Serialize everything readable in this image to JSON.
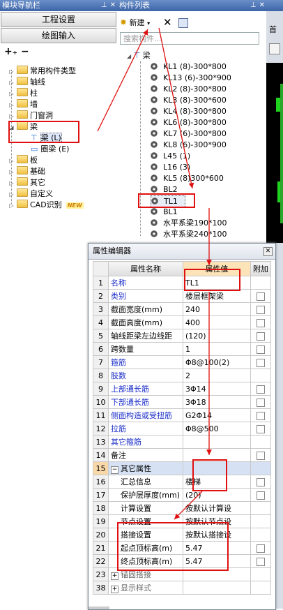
{
  "nav": {
    "title": "模块导航栏",
    "btn_project": "工程设置",
    "btn_draw": "绘图输入",
    "tree": [
      {
        "label": "常用构件类型",
        "exp": "▷"
      },
      {
        "label": "轴线",
        "exp": "▷"
      },
      {
        "label": "柱",
        "exp": "▷"
      },
      {
        "label": "墙",
        "exp": "▷"
      },
      {
        "label": "门窗洞",
        "exp": "▷"
      },
      {
        "label": "梁",
        "exp": "◢"
      },
      {
        "label": "梁 (L)",
        "exp": ""
      },
      {
        "label": "圈梁 (E)",
        "exp": ""
      },
      {
        "label": "板",
        "exp": "▷"
      },
      {
        "label": "基础",
        "exp": "▷"
      },
      {
        "label": "其它",
        "exp": "▷"
      },
      {
        "label": "自定义",
        "exp": "▷"
      },
      {
        "label": "CAD识别",
        "exp": "▷",
        "badge": "NEW"
      }
    ]
  },
  "comp": {
    "title": "构件列表",
    "new_label": "新建",
    "search_placeholder": "搜索构件...",
    "root": "梁",
    "items": [
      "KL1 (8)-300*800",
      "KL13 (6)-300*900",
      "KL2 (8)-300*800",
      "KL3 (8)-300*600",
      "KL4 (8)-300*800",
      "KL6 (8)-300*800",
      "KL7 (6)-300*800",
      "KL8 (6)-300*900",
      "L45 (1)",
      "L16 (3)",
      "KL5 (8)300*600",
      "BL2",
      "TL1",
      "BL1",
      "水平系梁190*100",
      "水平系梁240*100"
    ]
  },
  "strip": {
    "top_text": "首"
  },
  "prop": {
    "title": "属性编辑器",
    "col_name": "属性名称",
    "col_value": "属性值",
    "col_add": "附加",
    "rows": [
      {
        "n": "1",
        "name": "名称",
        "val": "TL1",
        "blue": true,
        "cb": false
      },
      {
        "n": "2",
        "name": "类别",
        "val": "楼层框架梁",
        "blue": true,
        "cb": true
      },
      {
        "n": "3",
        "name": "截面宽度(mm)",
        "val": "240",
        "blue": false,
        "cb": true
      },
      {
        "n": "4",
        "name": "截面高度(mm)",
        "val": "400",
        "blue": false,
        "cb": true
      },
      {
        "n": "5",
        "name": "轴线距梁左边线距",
        "val": "(120)",
        "blue": false,
        "cb": true
      },
      {
        "n": "6",
        "name": "跨数量",
        "val": "1",
        "blue": false,
        "cb": true
      },
      {
        "n": "7",
        "name": "箍筋",
        "val": "Φ8@100(2)",
        "blue": true,
        "cb": true
      },
      {
        "n": "8",
        "name": "肢数",
        "val": "2",
        "blue": true,
        "cb": false
      },
      {
        "n": "9",
        "name": "上部通长筋",
        "val": "3Φ14",
        "blue": true,
        "cb": true
      },
      {
        "n": "10",
        "name": "下部通长筋",
        "val": "3Φ18",
        "blue": true,
        "cb": true
      },
      {
        "n": "11",
        "name": "侧面构造或受扭筋",
        "val": "G2Φ14",
        "blue": true,
        "cb": true
      },
      {
        "n": "12",
        "name": "拉筋",
        "val": "Φ8@500",
        "blue": true,
        "cb": true
      },
      {
        "n": "13",
        "name": "其它箍筋",
        "val": "",
        "blue": true,
        "cb": false
      },
      {
        "n": "14",
        "name": "备注",
        "val": "",
        "blue": false,
        "cb": true
      },
      {
        "n": "15",
        "name": "其它属性",
        "val": "",
        "blue": false,
        "cb": false,
        "section": true,
        "pm": "−"
      },
      {
        "n": "16",
        "name": "汇总信息",
        "val": "楼梯",
        "blue": false,
        "cb": true,
        "indent": true
      },
      {
        "n": "17",
        "name": "保护层厚度(mm)",
        "val": "(20)",
        "blue": false,
        "cb": true,
        "indent": true
      },
      {
        "n": "18",
        "name": "计算设置",
        "val": "按默认计算设",
        "blue": false,
        "cb": false,
        "indent": true
      },
      {
        "n": "19",
        "name": "节点设置",
        "val": "按默认节点设",
        "blue": false,
        "cb": false,
        "indent": true
      },
      {
        "n": "20",
        "name": "搭接设置",
        "val": "按默认搭接设",
        "blue": false,
        "cb": false,
        "indent": true
      },
      {
        "n": "21",
        "name": "起点顶标高(m)",
        "val": "5.47",
        "blue": false,
        "cb": true,
        "indent": true
      },
      {
        "n": "22",
        "name": "终点顶标高(m)",
        "val": "5.47",
        "blue": false,
        "cb": true,
        "indent": true
      },
      {
        "n": "23",
        "name": "锚固搭接",
        "val": "",
        "blue": false,
        "cb": false,
        "pm": "+",
        "grey": true
      },
      {
        "n": "38",
        "name": "显示样式",
        "val": "",
        "blue": false,
        "cb": false,
        "pm": "+",
        "grey": true
      }
    ]
  },
  "colors": {
    "annotation": "#e01010",
    "link_blue": "#1a2dc8"
  }
}
